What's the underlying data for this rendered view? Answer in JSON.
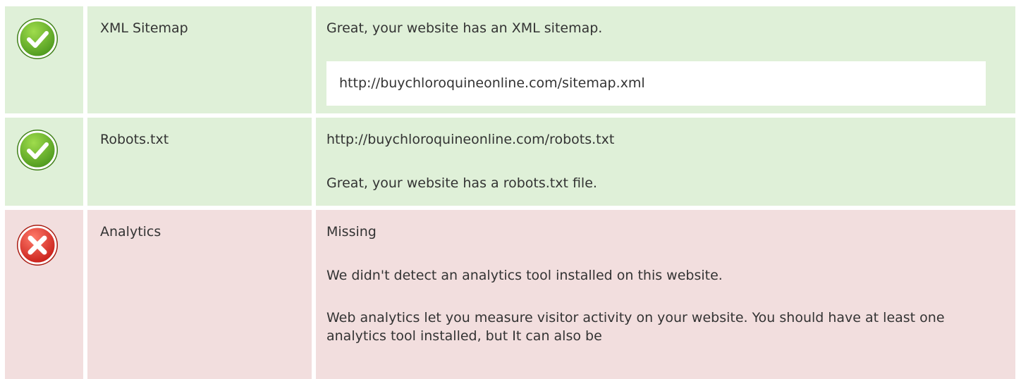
{
  "colors": {
    "ok_background": "#dff0d8",
    "bad_background": "#f2dede",
    "ok_icon": "#6ab12b",
    "bad_icon": "#d9342b",
    "text": "#333333"
  },
  "rows": [
    {
      "status": "pass",
      "icon": "check-circle-icon",
      "name": "XML Sitemap",
      "message": "Great, your website has an XML sitemap.",
      "url": "http://buychloroquineonline.com/sitemap.xml"
    },
    {
      "status": "pass",
      "icon": "check-circle-icon",
      "name": "Robots.txt",
      "url": "http://buychloroquineonline.com/robots.txt",
      "message": "Great, your website has a robots.txt file."
    },
    {
      "status": "fail",
      "icon": "cross-circle-icon",
      "name": "Analytics",
      "result": "Missing",
      "message": "We didn't detect an analytics tool installed on this website.",
      "detail": "Web analytics let you measure visitor activity on your website. You should have at least one analytics tool installed, but It can also be"
    }
  ]
}
